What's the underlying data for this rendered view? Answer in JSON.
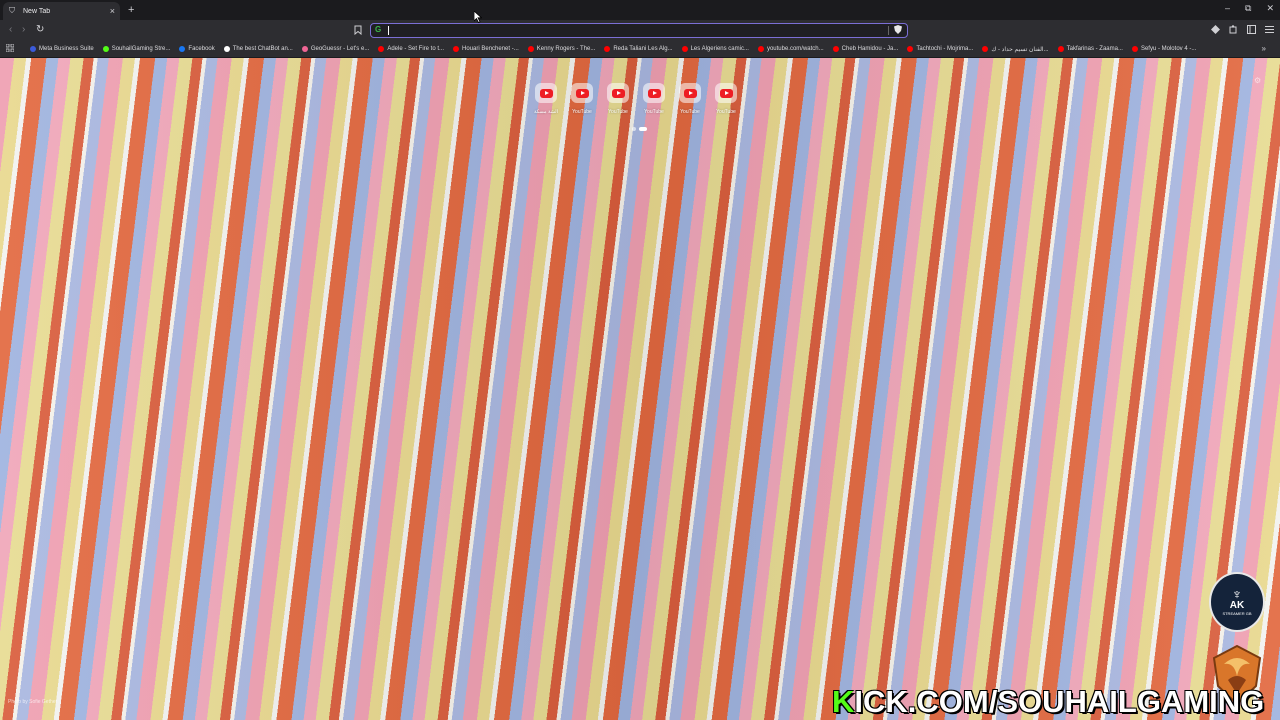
{
  "tab": {
    "title": "New Tab",
    "close": "×"
  },
  "tabstrip": {
    "new_tab": "+"
  },
  "window_controls": {
    "minimize": "–",
    "restore": "⧉",
    "close": "✕"
  },
  "toolbar": {
    "back": "‹",
    "forward": "›",
    "reload": "↻",
    "bookmark_star": "🔖",
    "menu": "≡",
    "extensions_icons": [
      "brave-rewards-icon",
      "extensions-icon",
      "sidebar-icon",
      "wallet-icon"
    ]
  },
  "address_bar": {
    "value": "",
    "placeholder": ""
  },
  "bookmarks": [
    {
      "label": "Meta Business Suite",
      "color": "#3b5bdb"
    },
    {
      "label": "SouhailGaming Stre...",
      "color": "#53fc18"
    },
    {
      "label": "Facebook",
      "color": "#1877f2"
    },
    {
      "label": "The best ChatBot an...",
      "color": "#ffffff"
    },
    {
      "label": "GeoGuessr - Let's e...",
      "color": "#f06595"
    },
    {
      "label": "Adele - Set Fire to t...",
      "color": "#ff0000"
    },
    {
      "label": "Houari Benchenet -...",
      "color": "#ff0000"
    },
    {
      "label": "Kenny Rogers - The...",
      "color": "#ff0000"
    },
    {
      "label": "Reda Taliani Les Alg...",
      "color": "#ff0000"
    },
    {
      "label": "Les Algeriens camic...",
      "color": "#ff0000"
    },
    {
      "label": "youtube.com/watch...",
      "color": "#ff0000"
    },
    {
      "label": "Cheb Hamidou - Ja...",
      "color": "#ff0000"
    },
    {
      "label": "Tachtochi - Mojrima...",
      "color": "#ff0000"
    },
    {
      "label": "الفنان تسيم حداد - ك...",
      "color": "#ff0000"
    },
    {
      "label": "Takfarinas - Zaama...",
      "color": "#ff0000"
    },
    {
      "label": "Sefyu - Molotov 4 -...",
      "color": "#ff0000"
    }
  ],
  "bookmarks_more": "»",
  "shortcuts": [
    {
      "label": "الشة مسكة"
    },
    {
      "label": "YouTube"
    },
    {
      "label": "YouTube"
    },
    {
      "label": "YouTube"
    },
    {
      "label": "YouTube"
    },
    {
      "label": "YouTube"
    }
  ],
  "photo_credit": "Photo by Sofie Gether",
  "overlay": {
    "logo_name": "AK",
    "logo_tag": "STREAMER GB",
    "stream_url_k": "K",
    "stream_url_rest": "ICK.COM/SOUHAILGAMING"
  }
}
